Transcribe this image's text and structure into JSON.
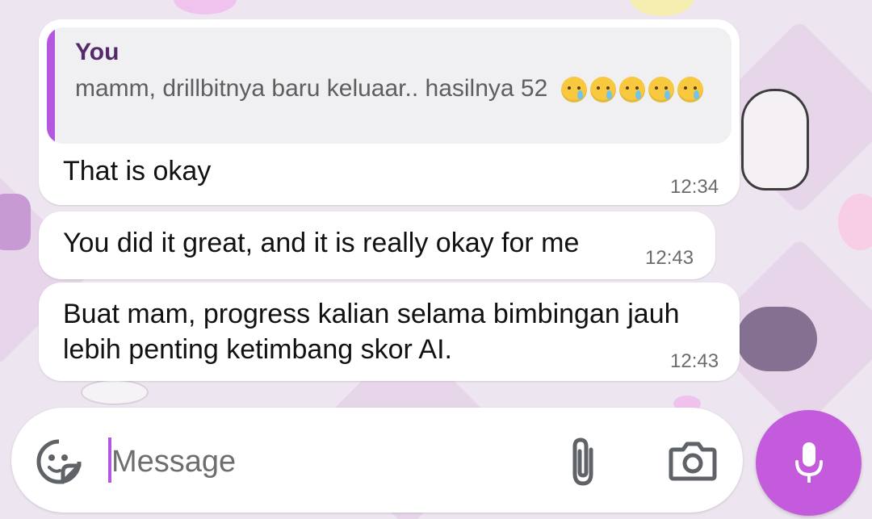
{
  "quoted_message": {
    "author": "You",
    "text": "mamm, drillbitnya baru keluaar.. hasilnya 52",
    "emoji_count": 5,
    "emoji_icon": "crying-face-emoji"
  },
  "messages": [
    {
      "text": "That is okay",
      "time": "12:34"
    },
    {
      "text": "You did it great, and it is really okay for me",
      "time": "12:43"
    },
    {
      "text": "Buat mam, progress kalian selama bimbingan jauh lebih penting ketimbang skor AI.",
      "time": "12:43"
    }
  ],
  "composer": {
    "placeholder": "Message",
    "sticker_icon": "sticker-icon",
    "attach_icon": "paperclip-icon",
    "camera_icon": "camera-icon",
    "mic_icon": "microphone-icon"
  },
  "colors": {
    "accent": "#c45bdc",
    "quote_bar": "#b457e0",
    "quote_author": "#542a6c",
    "bubble": "#ffffff",
    "wallpaper": "#ede6f0"
  }
}
